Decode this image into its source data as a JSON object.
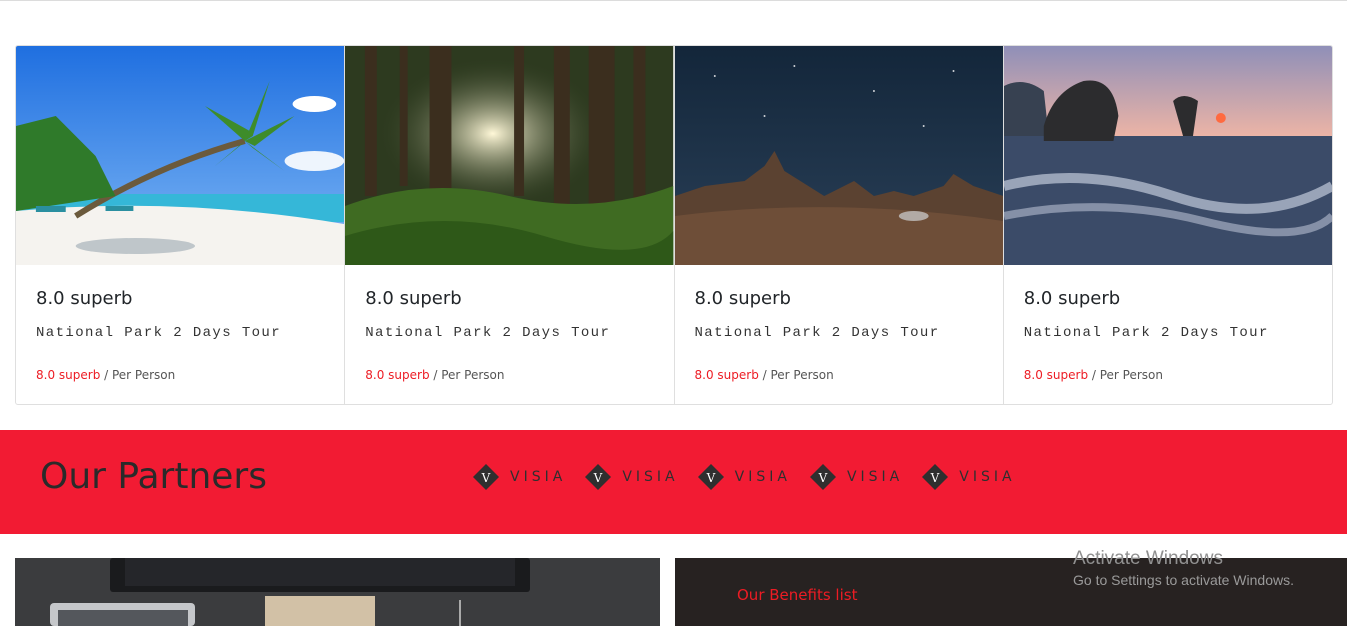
{
  "cards": [
    {
      "rating": "8.0 superb",
      "title": "National Park 2 Days Tour",
      "price_highlight": "8.0 superb",
      "price_suffix": " / Per Person",
      "image": "tropical-beach"
    },
    {
      "rating": "8.0 superb",
      "title": "National Park 2 Days Tour",
      "price_highlight": "8.0 superb",
      "price_suffix": " / Per Person",
      "image": "forest-sunlight"
    },
    {
      "rating": "8.0 superb",
      "title": "National Park 2 Days Tour",
      "price_highlight": "8.0 superb",
      "price_suffix": " / Per Person",
      "image": "desert-night"
    },
    {
      "rating": "8.0 superb",
      "title": "National Park 2 Days Tour",
      "price_highlight": "8.0 superb",
      "price_suffix": " / Per Person",
      "image": "rocky-sea-sunset"
    }
  ],
  "partners": {
    "title": "Our Partners",
    "logos": [
      {
        "letter": "V",
        "word": "VISIA"
      },
      {
        "letter": "V",
        "word": "VISIA"
      },
      {
        "letter": "V",
        "word": "VISIA"
      },
      {
        "letter": "V",
        "word": "VISIA"
      },
      {
        "letter": "V",
        "word": "VISIA"
      }
    ]
  },
  "benefits": {
    "label": "Our Benefits list"
  },
  "windows_watermark": {
    "title": "Activate Windows",
    "subtitle": "Go to Settings to activate Windows."
  },
  "colors": {
    "accent": "#f21b33",
    "highlight": "#ed1c24",
    "dark": "#272221"
  }
}
